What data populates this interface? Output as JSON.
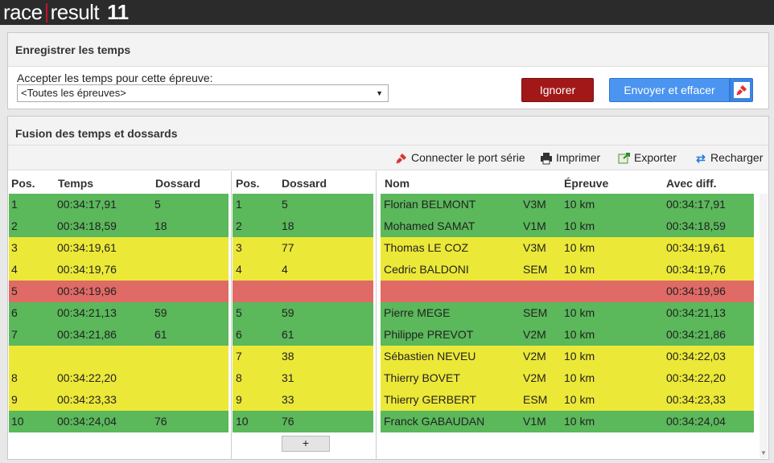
{
  "app": {
    "logo_race": "race",
    "logo_result": "result",
    "logo_version": "11"
  },
  "register": {
    "title": "Enregistrer les temps",
    "accept_label": "Accepter les temps pour cette épreuve:",
    "select_value": "<Toutes les épreuves>",
    "ignore_label": "Ignorer",
    "send_label": "Envoyer et effacer"
  },
  "merge": {
    "title": "Fusion des temps et dossards",
    "toolbar": {
      "connect": "Connecter le port série",
      "print": "Imprimer",
      "export": "Exporter",
      "reload": "Recharger"
    },
    "times_headers": [
      "Pos.",
      "Temps",
      "Dossard"
    ],
    "bibs_headers": [
      "Pos.",
      "Dossard"
    ],
    "results_headers": [
      "Nom",
      "Épreuve",
      "Avec diff."
    ],
    "times": [
      {
        "pos": "1",
        "time": "00:34:17,91",
        "bib": "5",
        "status": "g"
      },
      {
        "pos": "2",
        "time": "00:34:18,59",
        "bib": "18",
        "status": "g"
      },
      {
        "pos": "3",
        "time": "00:34:19,61",
        "bib": "",
        "status": "y"
      },
      {
        "pos": "4",
        "time": "00:34:19,76",
        "bib": "",
        "status": "y"
      },
      {
        "pos": "5",
        "time": "00:34:19,96",
        "bib": "",
        "status": "r"
      },
      {
        "pos": "6",
        "time": "00:34:21,13",
        "bib": "59",
        "status": "g"
      },
      {
        "pos": "7",
        "time": "00:34:21,86",
        "bib": "61",
        "status": "g"
      },
      {
        "pos": "",
        "time": "",
        "bib": "",
        "status": "y"
      },
      {
        "pos": "8",
        "time": "00:34:22,20",
        "bib": "",
        "status": "y"
      },
      {
        "pos": "9",
        "time": "00:34:23,33",
        "bib": "",
        "status": "y"
      },
      {
        "pos": "10",
        "time": "00:34:24,04",
        "bib": "76",
        "status": "g"
      }
    ],
    "bibs": [
      {
        "pos": "1",
        "bib": "5",
        "status": "g"
      },
      {
        "pos": "2",
        "bib": "18",
        "status": "g"
      },
      {
        "pos": "3",
        "bib": "77",
        "status": "y"
      },
      {
        "pos": "4",
        "bib": "4",
        "status": "y"
      },
      {
        "pos": "",
        "bib": "",
        "status": "r"
      },
      {
        "pos": "5",
        "bib": "59",
        "status": "g"
      },
      {
        "pos": "6",
        "bib": "61",
        "status": "g"
      },
      {
        "pos": "7",
        "bib": "38",
        "status": "y"
      },
      {
        "pos": "8",
        "bib": "31",
        "status": "y"
      },
      {
        "pos": "9",
        "bib": "33",
        "status": "y"
      },
      {
        "pos": "10",
        "bib": "76",
        "status": "g"
      }
    ],
    "results": [
      {
        "name": "Florian BELMONT",
        "cat": "V3M",
        "event": "10 km",
        "time": "00:34:17,91",
        "status": "g"
      },
      {
        "name": "Mohamed SAMAT",
        "cat": "V1M",
        "event": "10 km",
        "time": "00:34:18,59",
        "status": "g"
      },
      {
        "name": "Thomas LE COZ",
        "cat": "V3M",
        "event": "10 km",
        "time": "00:34:19,61",
        "status": "y"
      },
      {
        "name": "Cedric BALDONI",
        "cat": "SEM",
        "event": "10 km",
        "time": "00:34:19,76",
        "status": "y"
      },
      {
        "name": "",
        "cat": "",
        "event": "",
        "time": "00:34:19,96",
        "status": "r"
      },
      {
        "name": "Pierre MEGE",
        "cat": "SEM",
        "event": "10 km",
        "time": "00:34:21,13",
        "status": "g"
      },
      {
        "name": "Philippe PREVOT",
        "cat": "V2M",
        "event": "10 km",
        "time": "00:34:21,86",
        "status": "g"
      },
      {
        "name": "Sébastien NEVEU",
        "cat": "V2M",
        "event": "10 km",
        "time": "00:34:22,03",
        "status": "y"
      },
      {
        "name": "Thierry BOVET",
        "cat": "V2M",
        "event": "10 km",
        "time": "00:34:22,20",
        "status": "y"
      },
      {
        "name": "Thierry GERBERT",
        "cat": "ESM",
        "event": "10 km",
        "time": "00:34:23,33",
        "status": "y"
      },
      {
        "name": "Franck GABAUDAN",
        "cat": "V1M",
        "event": "10 km",
        "time": "00:34:24,04",
        "status": "g"
      }
    ],
    "add_label": "+"
  },
  "colors": {
    "green": "#5bb85b",
    "yellow": "#ebe838",
    "red": "#e06a65",
    "ignore": "#a21818",
    "send": "#4b94f0"
  }
}
